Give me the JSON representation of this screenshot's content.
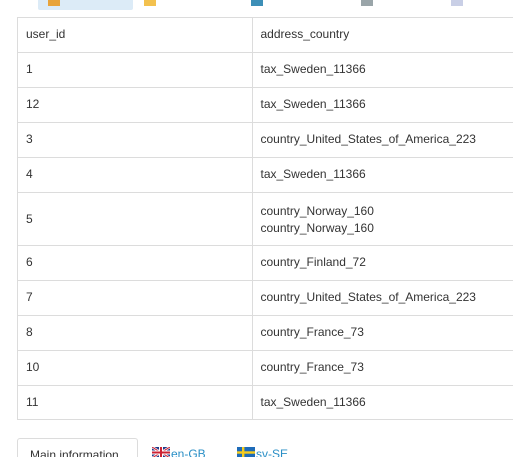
{
  "table": {
    "headers": {
      "user_id": "user_id",
      "address_country": "address_country"
    },
    "rows": [
      {
        "user_id": "1",
        "country": [
          "tax_Sweden_11366"
        ]
      },
      {
        "user_id": "12",
        "country": [
          "tax_Sweden_11366"
        ]
      },
      {
        "user_id": "3",
        "country": [
          "country_United_States_of_America_223"
        ]
      },
      {
        "user_id": "4",
        "country": [
          "tax_Sweden_11366"
        ]
      },
      {
        "user_id": "5",
        "country": [
          "country_Norway_160",
          "country_Norway_160"
        ]
      },
      {
        "user_id": "6",
        "country": [
          "country_Finland_72"
        ]
      },
      {
        "user_id": "7",
        "country": [
          "country_United_States_of_America_223"
        ]
      },
      {
        "user_id": "8",
        "country": [
          "country_France_73"
        ]
      },
      {
        "user_id": "10",
        "country": [
          "country_France_73"
        ]
      },
      {
        "user_id": "11",
        "country": [
          "tax_Sweden_11366"
        ]
      }
    ]
  },
  "bottom_tabs": {
    "main": "Main information",
    "en": "en-GB",
    "sv": "sv-SE"
  },
  "colors": {
    "border": "#dcdcdc",
    "link": "#2a8fc6",
    "active_tab": "#dcebf7"
  }
}
